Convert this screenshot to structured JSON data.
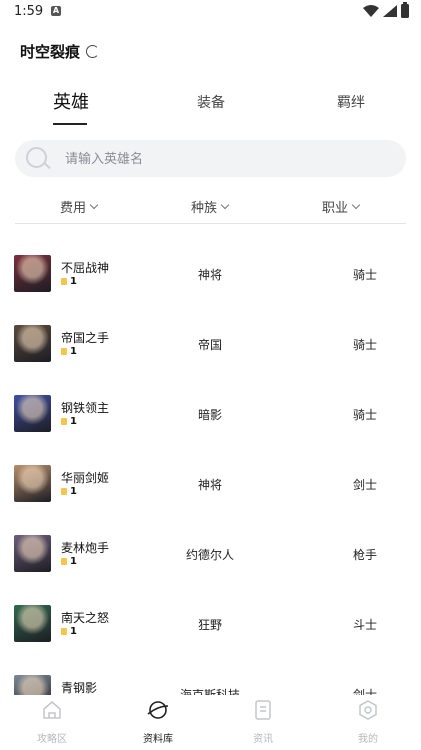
{
  "status_bar": {
    "time": "1:59",
    "app_badge": "A"
  },
  "header": {
    "title": "时空裂痕"
  },
  "tabs": [
    {
      "label": "英雄",
      "active": true
    },
    {
      "label": "装备",
      "active": false
    },
    {
      "label": "羁绊",
      "active": false
    }
  ],
  "search": {
    "placeholder": "请输入英雄名",
    "value": ""
  },
  "filters": [
    {
      "label": "费用"
    },
    {
      "label": "种族"
    },
    {
      "label": "职业"
    }
  ],
  "heroes": [
    {
      "name": "不屈战神",
      "cost": "1",
      "race": "神将",
      "class": "骑士",
      "avatar_color": "#7a2f3b"
    },
    {
      "name": "帝国之手",
      "cost": "1",
      "race": "帝国",
      "class": "骑士",
      "avatar_color": "#5b4a3c"
    },
    {
      "name": "钢铁领主",
      "cost": "1",
      "race": "暗影",
      "class": "骑士",
      "avatar_color": "#3e4fa3"
    },
    {
      "name": "华丽剑姬",
      "cost": "1",
      "race": "神将",
      "class": "剑士",
      "avatar_color": "#b88e6c"
    },
    {
      "name": "麦林炮手",
      "cost": "1",
      "race": "约德尔人",
      "class": "枪手",
      "avatar_color": "#6d5d7c"
    },
    {
      "name": "南天之怒",
      "cost": "1",
      "race": "狂野",
      "class": "斗士",
      "avatar_color": "#2f6a4d"
    },
    {
      "name": "青钢影",
      "cost": "",
      "race": "海克斯科技",
      "class": "剑士",
      "avatar_color": "#7c8a99"
    }
  ],
  "bottom_nav": [
    {
      "label": "攻略区",
      "icon": "home-icon",
      "active": false
    },
    {
      "label": "资料库",
      "icon": "planet-icon",
      "active": true
    },
    {
      "label": "资讯",
      "icon": "document-icon",
      "active": false
    },
    {
      "label": "我的",
      "icon": "gear-icon",
      "active": false
    }
  ]
}
